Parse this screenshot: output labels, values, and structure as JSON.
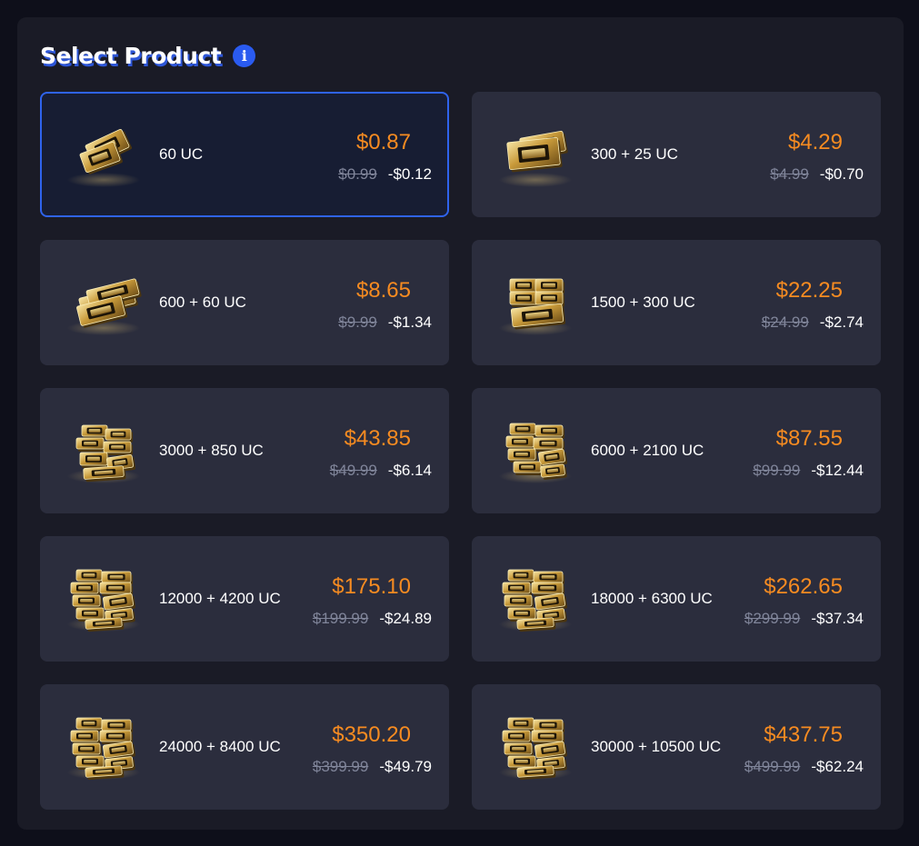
{
  "header": {
    "title": "Select Product",
    "info_icon": "info-icon",
    "info_glyph": "i"
  },
  "colors": {
    "panel": "#1a1b26",
    "card": "#2b2d3d",
    "selected_card": "#171d33",
    "selected_border": "#2f63ec",
    "price": "#f68b21",
    "old_price": "#80859a",
    "accent": "#2a5bf0"
  },
  "products": [
    {
      "name": "60 UC",
      "price": "$0.87",
      "old_price": "$0.99",
      "discount": "-$0.12",
      "selected": true,
      "icon": "uc-pack-icon"
    },
    {
      "name": "300 + 25 UC",
      "price": "$4.29",
      "old_price": "$4.99",
      "discount": "-$0.70",
      "selected": false,
      "icon": "uc-pack-icon"
    },
    {
      "name": "600 + 60 UC",
      "price": "$8.65",
      "old_price": "$9.99",
      "discount": "-$1.34",
      "selected": false,
      "icon": "uc-pack-icon"
    },
    {
      "name": "1500 + 300 UC",
      "price": "$22.25",
      "old_price": "$24.99",
      "discount": "-$2.74",
      "selected": false,
      "icon": "uc-pack-icon"
    },
    {
      "name": "3000 + 850 UC",
      "price": "$43.85",
      "old_price": "$49.99",
      "discount": "-$6.14",
      "selected": false,
      "icon": "uc-pack-icon"
    },
    {
      "name": "6000 + 2100 UC",
      "price": "$87.55",
      "old_price": "$99.99",
      "discount": "-$12.44",
      "selected": false,
      "icon": "uc-pack-icon"
    },
    {
      "name": "12000 + 4200 UC",
      "price": "$175.10",
      "old_price": "$199.99",
      "discount": "-$24.89",
      "selected": false,
      "icon": "uc-pack-icon"
    },
    {
      "name": "18000 + 6300 UC",
      "price": "$262.65",
      "old_price": "$299.99",
      "discount": "-$37.34",
      "selected": false,
      "icon": "uc-pack-icon"
    },
    {
      "name": "24000 + 8400 UC",
      "price": "$350.20",
      "old_price": "$399.99",
      "discount": "-$49.79",
      "selected": false,
      "icon": "uc-pack-icon"
    },
    {
      "name": "30000 + 10500 UC",
      "price": "$437.75",
      "old_price": "$499.99",
      "discount": "-$62.24",
      "selected": false,
      "icon": "uc-pack-icon"
    }
  ]
}
